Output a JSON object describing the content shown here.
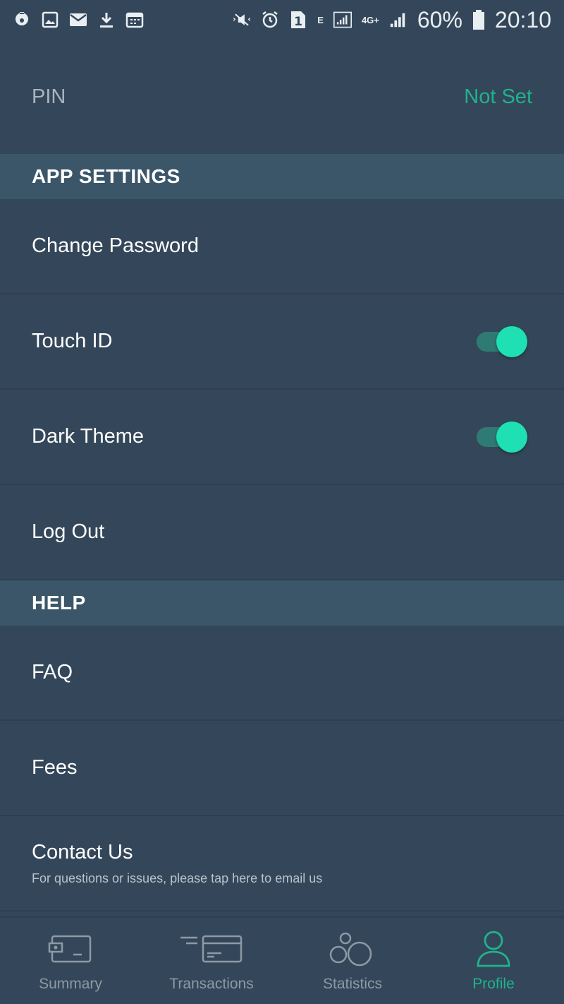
{
  "status_bar": {
    "battery": "60%",
    "time": "20:10",
    "network_e": "E",
    "network_4g": "4G+",
    "sim_badge": "1",
    "icons": [
      "location-pin-icon",
      "image-icon",
      "mail-icon",
      "download-icon",
      "calendar-icon",
      "mute-icon",
      "alarm-icon",
      "sim-icon",
      "signal-icon",
      "data-icon",
      "signal-icon",
      "battery-icon"
    ]
  },
  "pin": {
    "label": "PIN",
    "value": "Not Set"
  },
  "sections": {
    "app_settings": "APP SETTINGS",
    "help": "HELP"
  },
  "app_settings_items": {
    "change_password": "Change Password",
    "touch_id": "Touch ID",
    "dark_theme": "Dark Theme",
    "log_out": "Log Out"
  },
  "toggles": {
    "touch_id_on": true,
    "dark_theme_on": true
  },
  "help_items": {
    "faq": "FAQ",
    "fees": "Fees",
    "contact_us": "Contact Us",
    "contact_sub": "For questions or issues, please tap here to email us"
  },
  "nav": {
    "summary": "Summary",
    "transactions": "Transactions",
    "statistics": "Statistics",
    "profile": "Profile",
    "active": "profile"
  },
  "colors": {
    "background": "#34475a",
    "section_header": "#3b5668",
    "accent": "#1fb38d",
    "toggle_knob": "#1fe0b2"
  }
}
